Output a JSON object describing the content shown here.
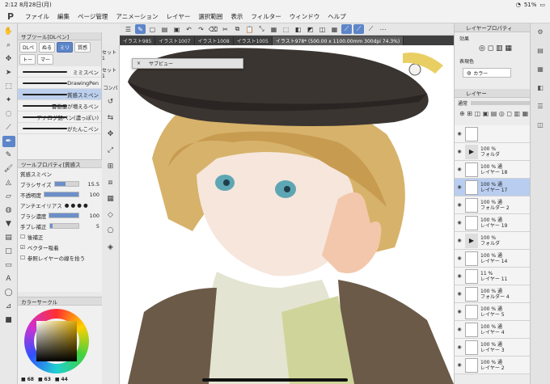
{
  "status": {
    "time": "2:12",
    "date": "8月28日(月)",
    "battery": "51%"
  },
  "menu": {
    "logo": "P",
    "items": [
      "ファイル",
      "編集",
      "ページ管理",
      "アニメーション",
      "レイヤー",
      "選択範囲",
      "表示",
      "フィルター",
      "ウィンドウ",
      "ヘルプ"
    ]
  },
  "tabs": [
    "イラスト985",
    "イラスト1007",
    "イラスト1008",
    "イラスト1005",
    "イラスト978* (500.00 x 1100.00mm 300dpi 74.3%)"
  ],
  "subtool": {
    "title": "サブツール[DLペン]",
    "groups": [
      "DLペ",
      "ぬる",
      "ミリ",
      "質感",
      "トー",
      "マー"
    ],
    "brushes": [
      "ミミスペン",
      "DrawingPen",
      "質感スミペン",
      "書檄墨が増えるペン",
      "アナログ鉛ペン(濃っぽい)",
      "がたんこペン"
    ],
    "selected": 2
  },
  "toolprop": {
    "title": "ツールプロパティ[質感ス",
    "brush_name": "質感スミペン",
    "rows": [
      {
        "label": "ブラシサイズ",
        "value": "15.5",
        "pct": 0.45
      },
      {
        "label": "不透明度",
        "value": "100",
        "pct": 1
      },
      {
        "label": "アンチエイリアス",
        "value": "",
        "pct": 0
      },
      {
        "label": "ブラシ濃度",
        "value": "100",
        "pct": 1
      },
      {
        "label": "手ブレ補正",
        "value": "5",
        "pct": 0.1
      },
      {
        "label": "後補正",
        "value": "",
        "pct": 0
      },
      {
        "label": "ベクター吸着",
        "value": "",
        "pct": 0
      },
      {
        "label": "参照レイヤーの線を拾う",
        "value": "",
        "pct": 0
      }
    ]
  },
  "color": {
    "title": "カラーサークル",
    "r": "68",
    "g": "63",
    "b": "44"
  },
  "side": {
    "labels": [
      "セット1",
      "セット1",
      "コンパ"
    ]
  },
  "subview": {
    "close": "×",
    "title": "サブビュー"
  },
  "layerprop": {
    "title": "レイヤープロパティ",
    "effect": "効果",
    "expression": "表現色",
    "expression_value": "カラー"
  },
  "layers": {
    "title": "レイヤー",
    "blend": "通常",
    "opacity": "100",
    "items": [
      {
        "pct": "",
        "name": "",
        "folder": false
      },
      {
        "pct": "100 %",
        "name": "フォルダ",
        "folder": true
      },
      {
        "pct": "100 % 通",
        "name": "レイヤー 18",
        "folder": false
      },
      {
        "pct": "100 % 通",
        "name": "レイヤー 17",
        "folder": false,
        "sel": true
      },
      {
        "pct": "100 % 通",
        "name": "フォルダー 2",
        "folder": false
      },
      {
        "pct": "100 % 通",
        "name": "レイヤー 19",
        "folder": false
      },
      {
        "pct": "100 %",
        "name": "フォルダ",
        "folder": true
      },
      {
        "pct": "100 % 通",
        "name": "レイヤー 14",
        "folder": false
      },
      {
        "pct": "11 %",
        "name": "レイヤー 11",
        "folder": false
      },
      {
        "pct": "100 % 通",
        "name": "フォルダー 4",
        "folder": false
      },
      {
        "pct": "100 % 通",
        "name": "レイヤー 5",
        "folder": false
      },
      {
        "pct": "100 % 通",
        "name": "レイヤー 4",
        "folder": false
      },
      {
        "pct": "100 % 通",
        "name": "レイヤー 3",
        "folder": false
      },
      {
        "pct": "100 % 通",
        "name": "レイヤー 2",
        "folder": false
      }
    ]
  }
}
